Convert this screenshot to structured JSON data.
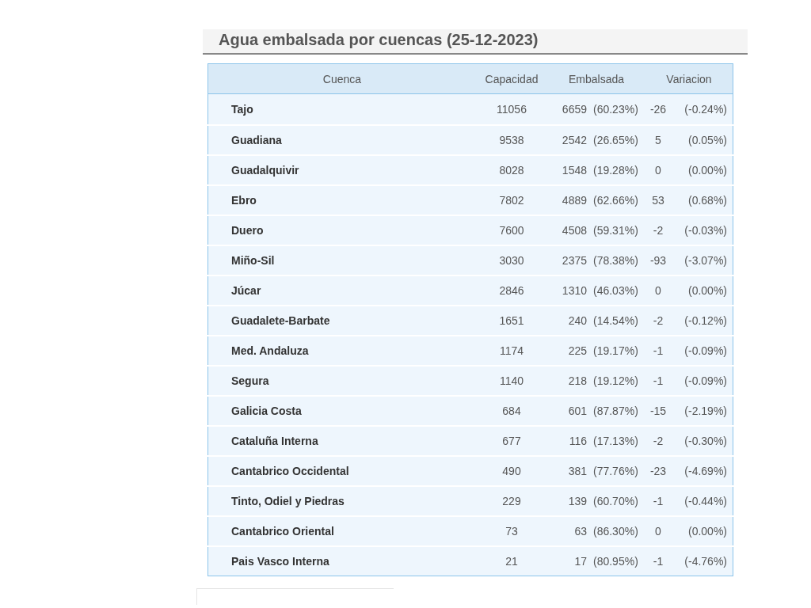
{
  "title": "Agua embalsada por cuencas (25-12-2023)",
  "table": {
    "columns": [
      {
        "label": "Cuenca"
      },
      {
        "label": "Capacidad"
      },
      {
        "label": "Embalsada"
      },
      {
        "label": "Variacion"
      }
    ],
    "rows": [
      {
        "cuenca": "Tajo",
        "capacidad": "11056",
        "embalsada": "6659",
        "embalsada_pct": "(60.23%)",
        "variacion": "-26",
        "variacion_pct": "(-0.24%)"
      },
      {
        "cuenca": "Guadiana",
        "capacidad": "9538",
        "embalsada": "2542",
        "embalsada_pct": "(26.65%)",
        "variacion": "5",
        "variacion_pct": "(0.05%)"
      },
      {
        "cuenca": "Guadalquivir",
        "capacidad": "8028",
        "embalsada": "1548",
        "embalsada_pct": "(19.28%)",
        "variacion": "0",
        "variacion_pct": "(0.00%)"
      },
      {
        "cuenca": "Ebro",
        "capacidad": "7802",
        "embalsada": "4889",
        "embalsada_pct": "(62.66%)",
        "variacion": "53",
        "variacion_pct": "(0.68%)"
      },
      {
        "cuenca": "Duero",
        "capacidad": "7600",
        "embalsada": "4508",
        "embalsada_pct": "(59.31%)",
        "variacion": "-2",
        "variacion_pct": "(-0.03%)"
      },
      {
        "cuenca": "Miño-Sil",
        "capacidad": "3030",
        "embalsada": "2375",
        "embalsada_pct": "(78.38%)",
        "variacion": "-93",
        "variacion_pct": "(-3.07%)"
      },
      {
        "cuenca": "Júcar",
        "capacidad": "2846",
        "embalsada": "1310",
        "embalsada_pct": "(46.03%)",
        "variacion": "0",
        "variacion_pct": "(0.00%)"
      },
      {
        "cuenca": "Guadalete-Barbate",
        "capacidad": "1651",
        "embalsada": "240",
        "embalsada_pct": "(14.54%)",
        "variacion": "-2",
        "variacion_pct": "(-0.12%)"
      },
      {
        "cuenca": "Med. Andaluza",
        "capacidad": "1174",
        "embalsada": "225",
        "embalsada_pct": "(19.17%)",
        "variacion": "-1",
        "variacion_pct": "(-0.09%)"
      },
      {
        "cuenca": "Segura",
        "capacidad": "1140",
        "embalsada": "218",
        "embalsada_pct": "(19.12%)",
        "variacion": "-1",
        "variacion_pct": "(-0.09%)"
      },
      {
        "cuenca": "Galicia Costa",
        "capacidad": "684",
        "embalsada": "601",
        "embalsada_pct": "(87.87%)",
        "variacion": "-15",
        "variacion_pct": "(-2.19%)"
      },
      {
        "cuenca": "Cataluña Interna",
        "capacidad": "677",
        "embalsada": "116",
        "embalsada_pct": "(17.13%)",
        "variacion": "-2",
        "variacion_pct": "(-0.30%)"
      },
      {
        "cuenca": "Cantabrico Occidental",
        "capacidad": "490",
        "embalsada": "381",
        "embalsada_pct": "(77.76%)",
        "variacion": "-23",
        "variacion_pct": "(-4.69%)"
      },
      {
        "cuenca": "Tinto, Odiel y Piedras",
        "capacidad": "229",
        "embalsada": "139",
        "embalsada_pct": "(60.70%)",
        "variacion": "-1",
        "variacion_pct": "(-0.44%)"
      },
      {
        "cuenca": "Cantabrico Oriental",
        "capacidad": "73",
        "embalsada": "63",
        "embalsada_pct": "(86.30%)",
        "variacion": "0",
        "variacion_pct": "(0.00%)"
      },
      {
        "cuenca": "Pais Vasco Interna",
        "capacidad": "21",
        "embalsada": "17",
        "embalsada_pct": "(80.95%)",
        "variacion": "-1",
        "variacion_pct": "(-4.76%)"
      }
    ]
  }
}
